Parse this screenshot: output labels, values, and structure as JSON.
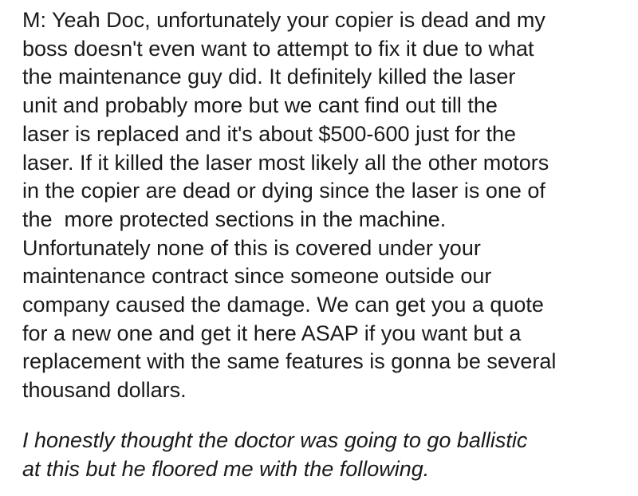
{
  "dialogue_lines": [
    "M: Yeah Doc, unfortunately your copier is dead and my",
    "boss doesn't even want to attempt to fix it due to what",
    "the maintenance guy did. It definitely killed the laser",
    "unit and probably more but we cant find out till the",
    "laser is replaced and it's about $500-600 just for the",
    "laser. If it killed the laser most likely all the other motors",
    "in the copier are dead or dying since the laser is one of",
    "the  more protected sections in the machine.",
    "Unfortunately none of this is covered under your",
    "maintenance contract since someone outside our",
    "company caused the damage. We can get you a quote",
    "for a new one and get it here ASAP if you want but a",
    "replacement with the same features is gonna be several",
    "thousand dollars."
  ],
  "narration_lines": [
    "I honestly thought the doctor was going to go ballistic",
    "at this but he floored me with the following."
  ],
  "colors": {
    "text": "#1a1a1a",
    "background": "#ffffff"
  }
}
